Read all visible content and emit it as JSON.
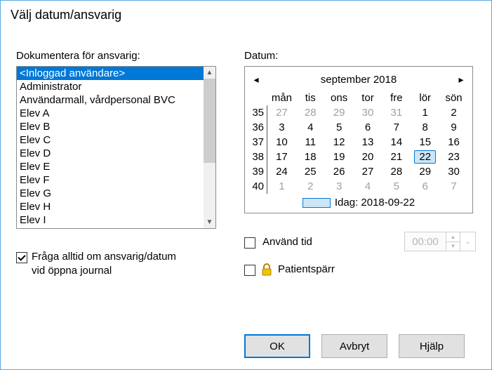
{
  "window_title": "Välj datum/ansvarig",
  "left": {
    "label": "Dokumentera för ansvarig:",
    "items": [
      "<Inloggad användare>",
      "Administrator",
      "Användarmall, vårdpersonal BVC",
      "Elev A",
      "Elev B",
      "Elev C",
      "Elev D",
      "Elev E",
      "Elev F",
      "Elev G",
      "Elev H",
      "Elev I"
    ],
    "selected_index": "0",
    "always_ask_label_line1": "Fråga alltid om ansvarig/datum",
    "always_ask_label_line2": "vid öppna journal"
  },
  "right": {
    "label": "Datum:",
    "month_title": "september 2018",
    "dow": [
      "mån",
      "tis",
      "ons",
      "tor",
      "fre",
      "lör",
      "sön"
    ],
    "weeks": [
      {
        "wk": "35",
        "days": [
          {
            "n": "27",
            "out": true
          },
          {
            "n": "28",
            "out": true
          },
          {
            "n": "29",
            "out": true
          },
          {
            "n": "30",
            "out": true
          },
          {
            "n": "31",
            "out": true
          },
          {
            "n": "1"
          },
          {
            "n": "2"
          }
        ]
      },
      {
        "wk": "36",
        "days": [
          {
            "n": "3"
          },
          {
            "n": "4"
          },
          {
            "n": "5"
          },
          {
            "n": "6"
          },
          {
            "n": "7"
          },
          {
            "n": "8"
          },
          {
            "n": "9"
          }
        ]
      },
      {
        "wk": "37",
        "days": [
          {
            "n": "10"
          },
          {
            "n": "11"
          },
          {
            "n": "12"
          },
          {
            "n": "13"
          },
          {
            "n": "14"
          },
          {
            "n": "15"
          },
          {
            "n": "16"
          }
        ]
      },
      {
        "wk": "38",
        "days": [
          {
            "n": "17"
          },
          {
            "n": "18"
          },
          {
            "n": "19"
          },
          {
            "n": "20"
          },
          {
            "n": "21"
          },
          {
            "n": "22",
            "selected": true
          },
          {
            "n": "23"
          }
        ]
      },
      {
        "wk": "39",
        "days": [
          {
            "n": "24"
          },
          {
            "n": "25"
          },
          {
            "n": "26"
          },
          {
            "n": "27"
          },
          {
            "n": "28"
          },
          {
            "n": "29"
          },
          {
            "n": "30"
          }
        ]
      },
      {
        "wk": "40",
        "days": [
          {
            "n": "1",
            "out": true
          },
          {
            "n": "2",
            "out": true
          },
          {
            "n": "3",
            "out": true
          },
          {
            "n": "4",
            "out": true
          },
          {
            "n": "5",
            "out": true
          },
          {
            "n": "6",
            "out": true
          },
          {
            "n": "7",
            "out": true
          }
        ]
      }
    ],
    "today_label": "Idag: 2018-09-22",
    "use_time_label": "Använd tid",
    "time_value": "00:00",
    "patient_lock_label": "Patientspärr"
  },
  "buttons": {
    "ok": "OK",
    "cancel": "Avbryt",
    "help": "Hjälp"
  }
}
